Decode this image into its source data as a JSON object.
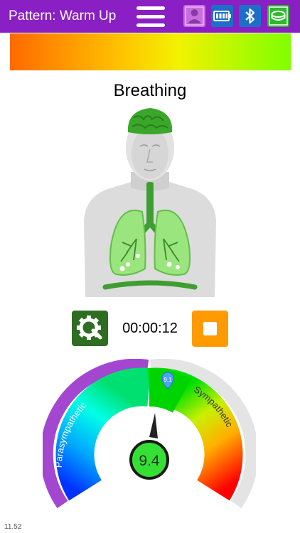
{
  "header": {
    "title": "Pattern: Warm Up",
    "icons": [
      "menu-icon",
      "profile-icon",
      "battery-icon",
      "bluetooth-icon",
      "device-icon"
    ],
    "background": "#8a1fc4"
  },
  "heading": "Breathing",
  "timer": "00:00:12",
  "controls": {
    "settings_color": "#2e6e22",
    "stop_color": "#ff9a00"
  },
  "gauge": {
    "value": "9.4",
    "marker": "9.1",
    "left_label": "Parasympathetic",
    "right_label": "Sympathetic"
  },
  "footer": "11.52"
}
